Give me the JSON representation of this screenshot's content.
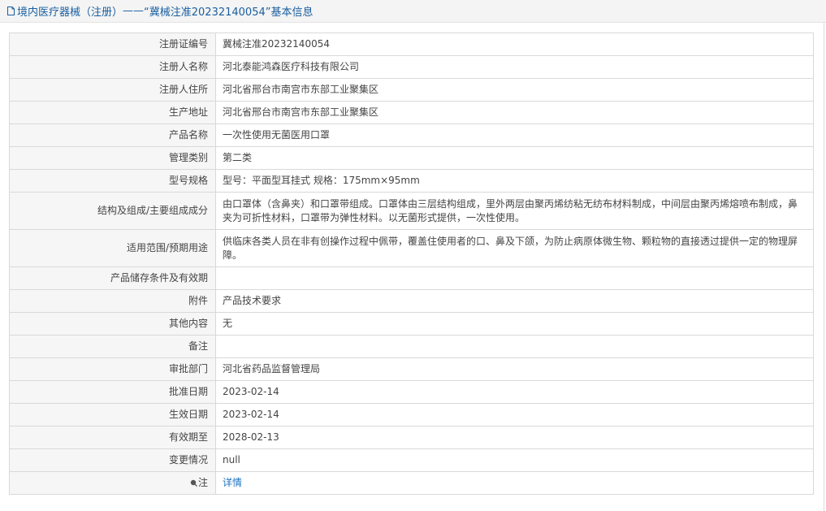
{
  "header": {
    "prefix": "境内医疗器械（注册）",
    "separator": "——",
    "reg_no_quoted": "“冀械注准20232140054”",
    "suffix": "基本信息"
  },
  "rows": [
    {
      "label": "注册证编号",
      "value": "冀械注准20232140054"
    },
    {
      "label": "注册人名称",
      "value": "河北泰能鸿森医疗科技有限公司"
    },
    {
      "label": "注册人住所",
      "value": "河北省邢台市南宫市东部工业聚集区"
    },
    {
      "label": "生产地址",
      "value": "河北省邢台市南宫市东部工业聚集区"
    },
    {
      "label": "产品名称",
      "value": "一次性使用无菌医用口罩"
    },
    {
      "label": "管理类别",
      "value": "第二类"
    },
    {
      "label": "型号规格",
      "value": "型号：平面型耳挂式 规格：175mm×95mm"
    },
    {
      "label": "结构及组成/主要组成成分",
      "value": "由口罩体（含鼻夹）和口罩带组成。口罩体由三层结构组成，里外两层由聚丙烯纺粘无纺布材料制成，中间层由聚丙烯熔喷布制成，鼻夹为可折性材料，口罩带为弹性材料。以无菌形式提供，一次性使用。"
    },
    {
      "label": "适用范围/预期用途",
      "value": "供临床各类人员在非有创操作过程中佩带，覆盖住使用者的口、鼻及下颌，为防止病原体微生物、颗粒物的直接透过提供一定的物理屏障。"
    },
    {
      "label": "产品储存条件及有效期",
      "value": ""
    },
    {
      "label": "附件",
      "value": "产品技术要求"
    },
    {
      "label": "其他内容",
      "value": "无"
    },
    {
      "label": "备注",
      "value": ""
    },
    {
      "label": "审批部门",
      "value": "河北省药品监督管理局"
    },
    {
      "label": "批准日期",
      "value": "2023-02-14"
    },
    {
      "label": "生效日期",
      "value": "2023-02-14"
    },
    {
      "label": "有效期至",
      "value": "2028-02-13"
    },
    {
      "label": "变更情况",
      "value": "null"
    }
  ],
  "note_row": {
    "label": "注",
    "link": "详情"
  },
  "colors": {
    "header_text": "#1a5fa0",
    "link": "#1e73be",
    "label_bg": "#f6f6f6",
    "border": "#d9d9d9"
  },
  "icons": {
    "header": "document-icon",
    "note": "pin-icon"
  }
}
